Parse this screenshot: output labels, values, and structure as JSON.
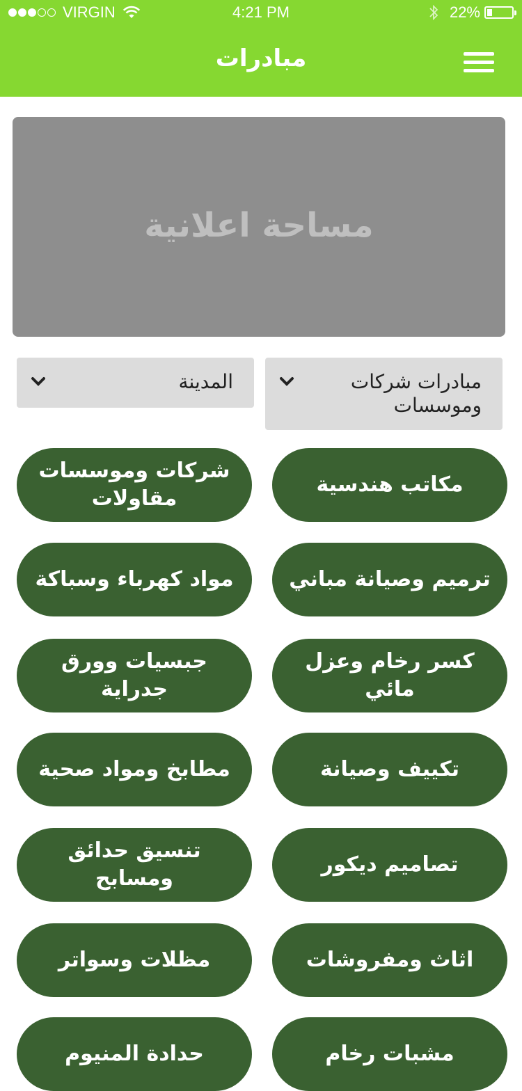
{
  "status_bar": {
    "carrier": "VIRGIN",
    "time": "4:21 PM",
    "battery": "22%",
    "battery_level": 0.22,
    "signal_bars_filled": 3,
    "signal_bars_total": 5
  },
  "header": {
    "title": "مبادرات",
    "menu_icon": "hamburger-menu-icon",
    "background_color": "#86d831"
  },
  "ad_banner": {
    "text": "مساحة اعلانية"
  },
  "filters": {
    "category": "مبادرات شركات وموسسات",
    "city": "المدينة"
  },
  "categories": [
    "مكاتب هندسية",
    "شركات وموسسات مقاولات",
    "ترميم وصيانة مباني",
    "مواد كهرباء وسباكة",
    "كسر رخام وعزل مائي",
    "جبسيات وورق جدراية",
    "تكييف وصيانة",
    "مطابخ ومواد صحية",
    "تصاميم ديكور",
    "تنسيق حدائق ومسابح",
    "اثاث ومفروشات",
    "مظلات وسواتر",
    "مشبات رخام",
    "حدادة المنيوم"
  ],
  "colors": {
    "accent": "#86d831",
    "button": "#3a6131",
    "dropdown": "#dcdcdc",
    "ad_background": "#8e8e8e"
  }
}
